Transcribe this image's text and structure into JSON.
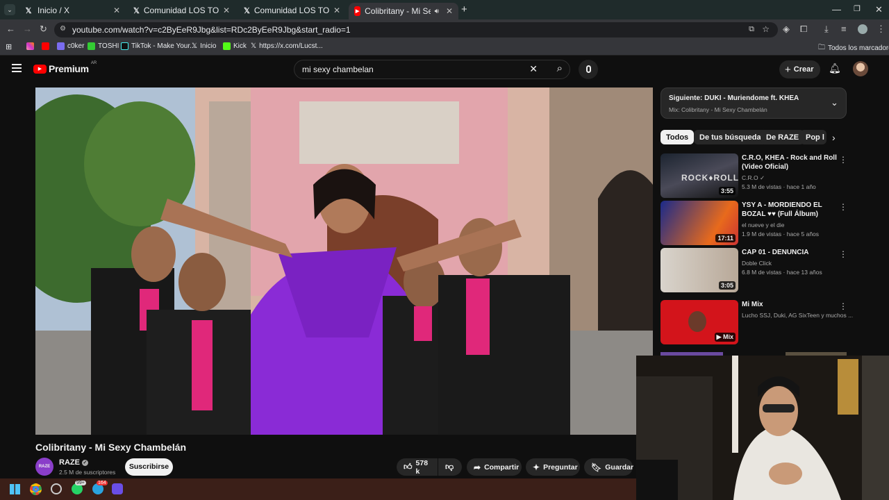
{
  "browser": {
    "tabs": [
      {
        "title": "Inicio / X",
        "icon": "x-icon"
      },
      {
        "title": "Comunidad LOS TOP GLOBALES",
        "icon": "x-icon"
      },
      {
        "title": "Comunidad LOS TOP GLOBALES",
        "icon": "x-icon"
      },
      {
        "title": "Colibritany - Mi Sexy Cham",
        "icon": "youtube-icon",
        "active": true
      }
    ],
    "url": "youtube.com/watch?v=c2ByEeR9Jbg&list=RDc2ByEeR9Jbg&start_radio=1",
    "bookmarks": [
      {
        "label": "",
        "icon": "instagram-icon"
      },
      {
        "label": "",
        "icon": "youtube-icon"
      },
      {
        "label": "c0ker",
        "icon": "bookmark-icon"
      },
      {
        "label": "TOSHI",
        "icon": "bookmark-icon"
      },
      {
        "label": "TikTok - Make Your...",
        "icon": "tiktok-icon"
      },
      {
        "label": "Inicio",
        "icon": "x-icon"
      },
      {
        "label": "Kick",
        "icon": "kick-icon"
      },
      {
        "label": "https://x.com/Lucst...",
        "icon": "x-icon"
      }
    ],
    "all_bookmarks": "Todos los marcadores"
  },
  "youtube": {
    "logo": "Premium",
    "region": "AR",
    "search_value": "mi sexy chambelan",
    "create_label": "Crear",
    "video_title": "Colibritany - Mi Sexy Chambelán",
    "channel": {
      "name": "RAZE",
      "subscribers": "2.5 M de suscriptores",
      "avatar_text": "RAZE"
    },
    "subscribe_label": "Suscribirse",
    "actions": {
      "likes": "578 k",
      "share": "Compartir",
      "ask": "Preguntar",
      "save": "Guardar"
    },
    "up_next": {
      "label": "Siguiente: DUKI - Muriendome ft. KHEA",
      "mix": "Mix: Colibritany - Mi Sexy Chambelán"
    },
    "chips": [
      "Todos",
      "De tus búsquedas",
      "De RAZE",
      "Pop l"
    ],
    "recommendations": [
      {
        "title": "C.R.O, KHEA - Rock and Roll (Video Oficial)",
        "channel": "C.R.O",
        "meta": "5.3 M de vistas · hace 1 año",
        "duration": "3:55"
      },
      {
        "title": "YSY A - MORDIENDO EL BOZAL ♥♥ (Full Álbum)",
        "channel": "el nueve y el die",
        "meta": "1.9 M de vistas · hace 5 años",
        "duration": "17:11"
      },
      {
        "title": "CAP 01 - DENUNCIA",
        "channel": "Doble Click",
        "meta": "6.8 M de vistas · hace 13 años",
        "duration": "3:05"
      },
      {
        "title": "Mi Mix",
        "channel": "Lucho SSJ, Duki, AG SixTeen y muchos ...",
        "meta": "",
        "duration": "Mix"
      }
    ]
  },
  "taskbar": {
    "whatsapp_badge": "99+",
    "telegram_badge": "164"
  },
  "colors": {
    "accent": "#ff0000",
    "chip_bg": "#272727",
    "tabbar": "#1f2b2b"
  }
}
